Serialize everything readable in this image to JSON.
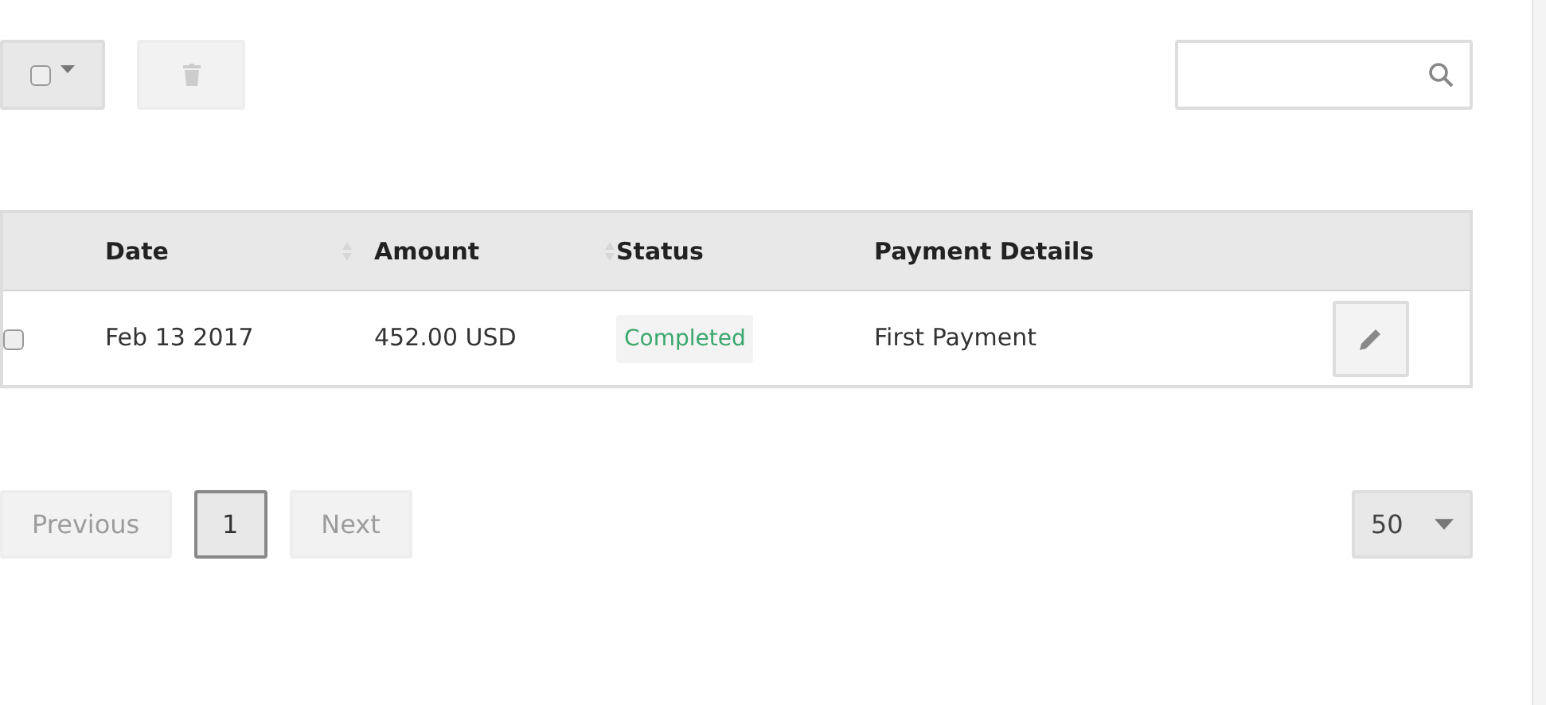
{
  "toolbar": {
    "select_all": {
      "checked": false
    },
    "delete": {
      "disabled": true
    }
  },
  "table": {
    "columns": [
      {
        "label": "Date",
        "sortable": true
      },
      {
        "label": "Amount",
        "sortable": true
      },
      {
        "label": "Status",
        "sortable": false
      },
      {
        "label": "Payment Details",
        "sortable": false
      }
    ],
    "rows": [
      {
        "checked": false,
        "date": "Feb 13 2017",
        "amount": "452.00 USD",
        "status": "Completed",
        "details": "First Payment"
      }
    ]
  },
  "pagination": {
    "previous": {
      "label": "Previous",
      "disabled": true
    },
    "pages": [
      {
        "label": "1",
        "selected": true
      }
    ],
    "next": {
      "label": "Next",
      "disabled": true
    }
  },
  "page_size": "50"
}
